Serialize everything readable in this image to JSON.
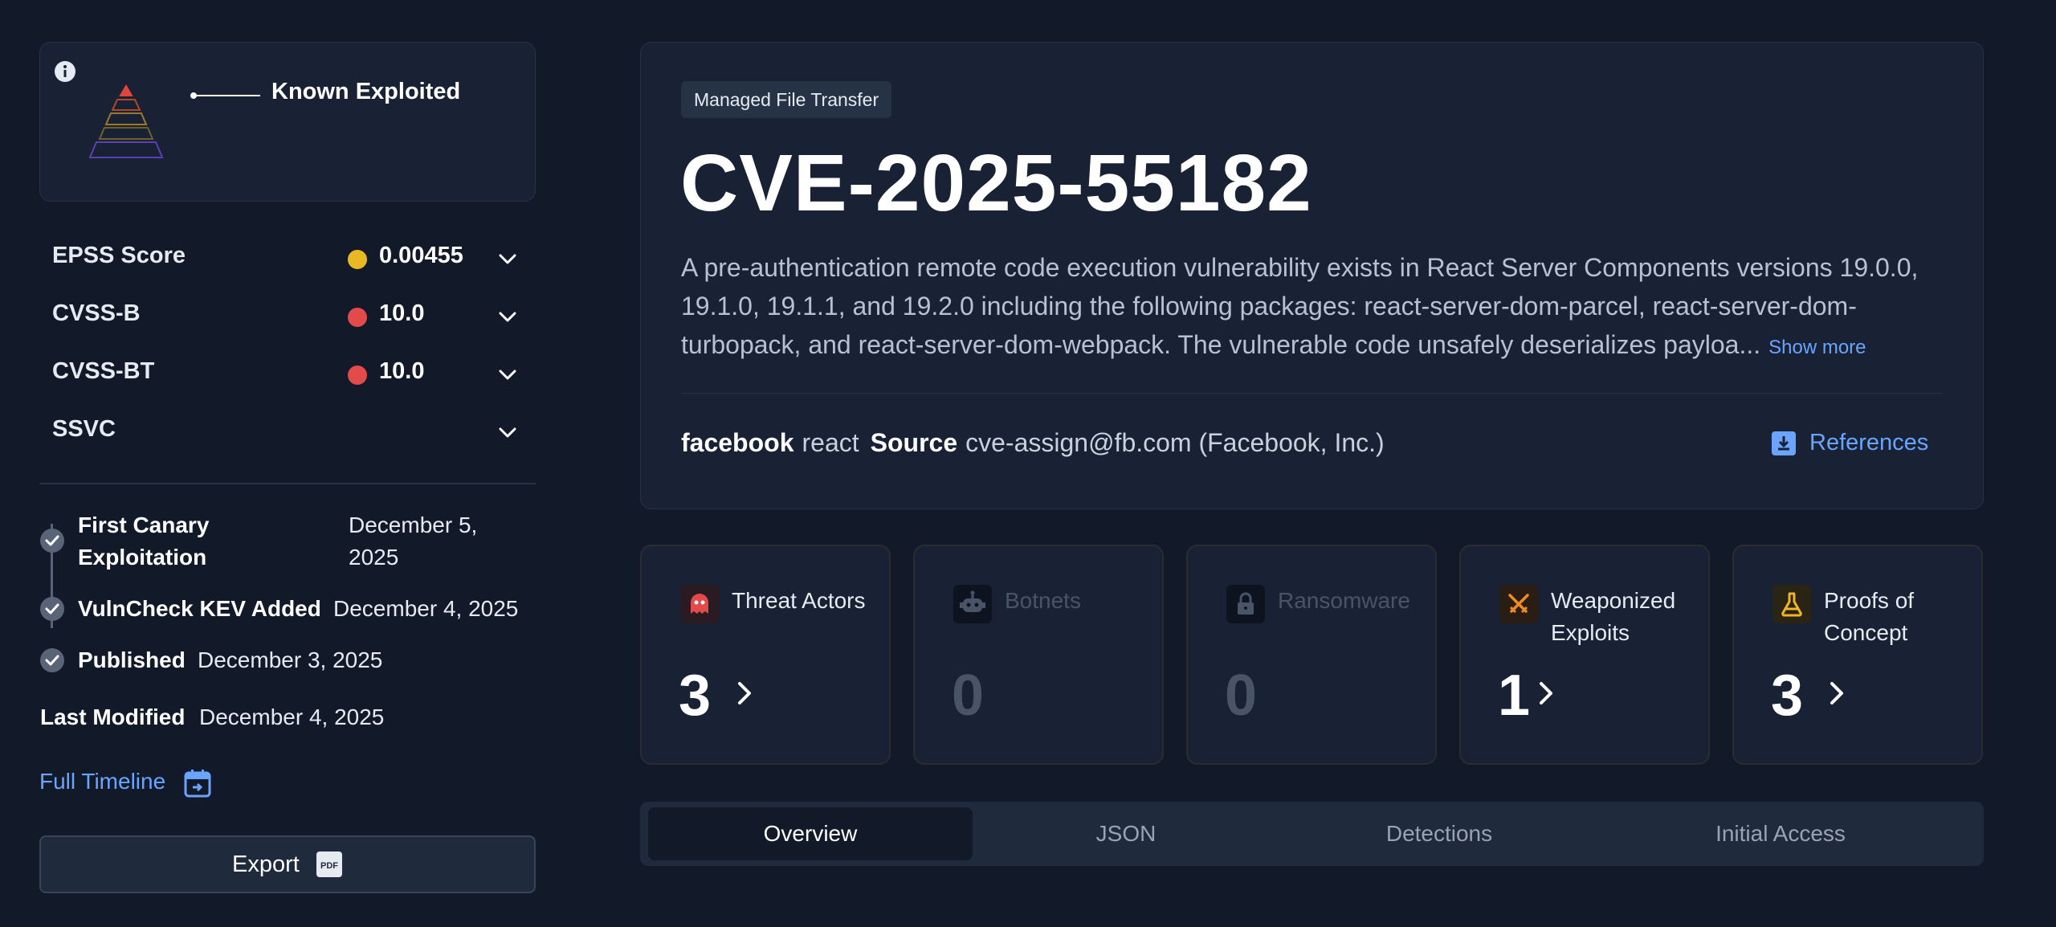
{
  "kev": {
    "label": "Known Exploited",
    "info_icon": "info-icon",
    "pyramid_icon": "risk-pyramid-icon",
    "pyramid_colors": [
      "#e0453c",
      "#b4472a",
      "#9a7a2a",
      "#6e5f2c",
      "#5b3fb3"
    ]
  },
  "scores": [
    {
      "name": "EPSS Score",
      "value": "0.00455",
      "color": "#e8b923"
    },
    {
      "name": "CVSS-B",
      "value": "10.0",
      "color": "#e34a4a"
    },
    {
      "name": "CVSS-BT",
      "value": "10.0",
      "color": "#e34a4a"
    },
    {
      "name": "SSVC",
      "value": "",
      "color": ""
    }
  ],
  "timeline": {
    "events": [
      {
        "title_line1": "First Canary",
        "title_line2": "Exploitation",
        "date_line1": "December 5,",
        "date_line2": "2025"
      },
      {
        "title": "VulnCheck KEV Added",
        "date": "December 4, 2025"
      },
      {
        "title": "Published",
        "date": "December 3, 2025"
      }
    ],
    "last_modified_label": "Last Modified",
    "last_modified_date": "December 4, 2025",
    "full_timeline_label": "Full Timeline"
  },
  "export": {
    "label": "Export",
    "icon": "pdf-icon"
  },
  "main": {
    "category": "Managed File Transfer",
    "cve_id": "CVE-2025-55182",
    "description": "A pre-authentication remote code execution vulnerability exists in React Server Components versions 19.0.0, 19.1.0, 19.1.1, and 19.2.0 including the following packages: react-server-dom-parcel, react-server-dom-turbopack, and react-server-dom-webpack. The vulnerable code unsafely deserializes payloa...",
    "show_more": "Show more",
    "vendor": "facebook",
    "product": "react",
    "source_label": "Source",
    "source": "cve-assign@fb.com (Facebook, Inc.)",
    "references_label": "References"
  },
  "stats": [
    {
      "label": "Threat Actors",
      "count": "3",
      "icon": "ghost-icon",
      "active": true
    },
    {
      "label": "Botnets",
      "count": "0",
      "icon": "robot-icon",
      "active": false
    },
    {
      "label": "Ransomware",
      "count": "0",
      "icon": "lock-icon",
      "active": false
    },
    {
      "label": "Weaponized Exploits",
      "count": "1",
      "icon": "crossed-swords-icon",
      "active": true
    },
    {
      "label": "Proofs of Concept",
      "count": "3",
      "icon": "flask-icon",
      "active": true
    }
  ],
  "tabs": [
    {
      "label": "Overview",
      "active": true
    },
    {
      "label": "JSON",
      "active": false
    },
    {
      "label": "Detections",
      "active": false
    },
    {
      "label": "Initial Access",
      "active": false
    }
  ],
  "colors": {
    "accent_link": "#6aa4ff",
    "background": "#121a2a",
    "card": "#182234",
    "threat_red": "#e34a4a",
    "exploit_orange": "#f08a24",
    "poc_yellow": "#f0b429"
  }
}
